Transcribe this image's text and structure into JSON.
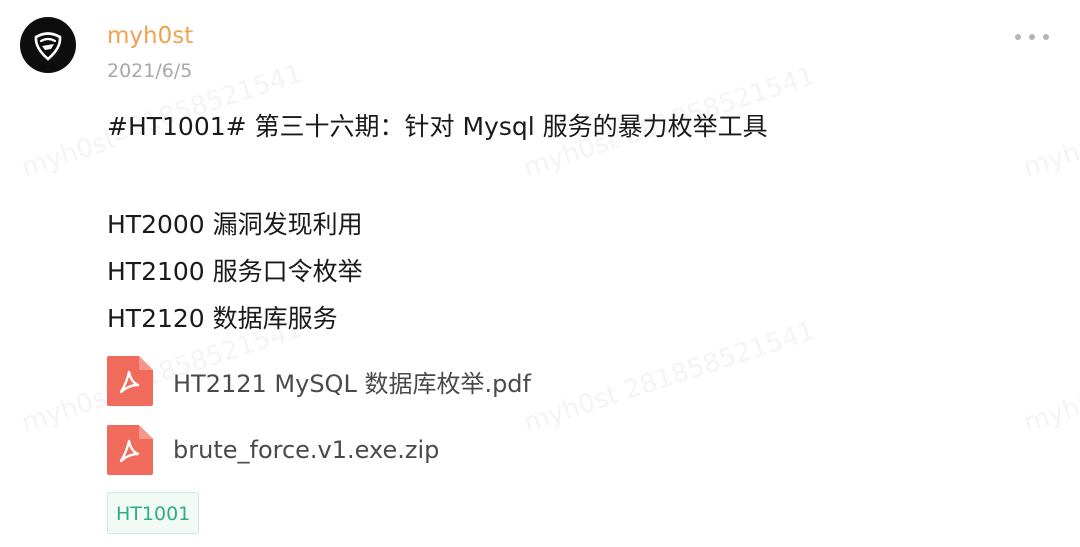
{
  "post": {
    "author": "myh0st",
    "date": "2021/6/5",
    "title": "#HT1001# 第三十六期：针对 Mysql 服务的暴力枚举工具",
    "lines": [
      "HT2000 漏洞发现利用",
      "HT2100 服务口令枚举",
      "HT2120 数据库服务"
    ],
    "attachments": [
      {
        "name": "HT2121 MySQL 数据库枚举.pdf",
        "icon": "pdf-file-icon"
      },
      {
        "name": "brute_force.v1.exe.zip",
        "icon": "pdf-file-icon"
      }
    ],
    "tag": "HT1001"
  },
  "watermark": {
    "text_left": "myh0st",
    "text_mid": "myh0st 281858521541",
    "text_num": "281858521541"
  },
  "colors": {
    "author": "#f0a250",
    "date": "#a8a8a8",
    "tag_text": "#2fae7f",
    "file_icon": "#f06b5b"
  },
  "icons": {
    "avatar": "avatar-logo-icon",
    "more": "more-options-icon"
  }
}
